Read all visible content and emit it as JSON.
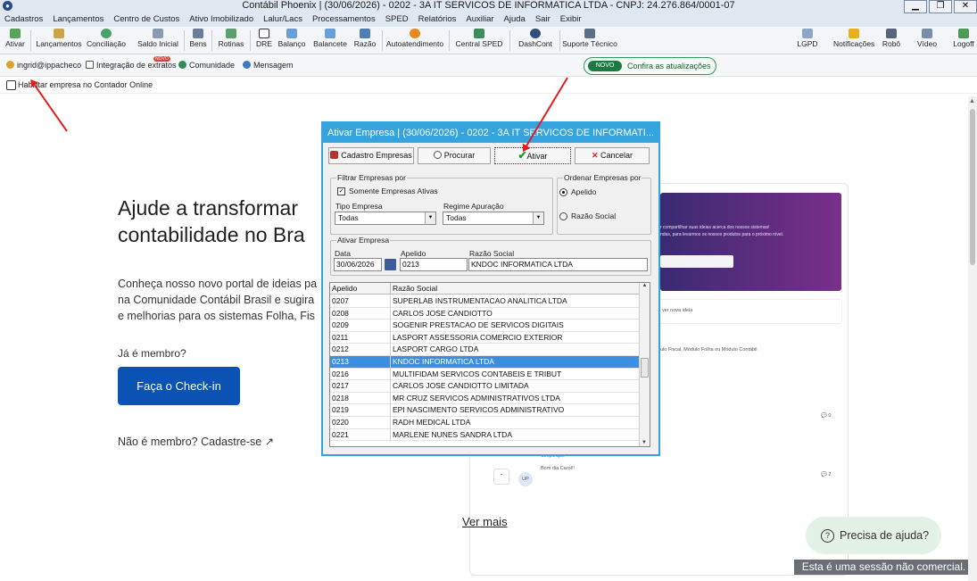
{
  "window": {
    "title": "Contábil Phoenix | (30/06/2026) - 0202 - 3A IT SERVICOS DE INFORMATICA LTDA - CNPJ: 24.276.864/0001-07",
    "minimize": "▁",
    "restore": "❐",
    "close": "✕"
  },
  "menu": [
    "Cadastros",
    "Lançamentos",
    "Centro de Custos",
    "Ativo Imobilizado",
    "Lalur/Lacs",
    "Processamentos",
    "SPED",
    "Relatórios",
    "Auxiliar",
    "Ajuda",
    "Sair",
    "Exibir"
  ],
  "toolbar": {
    "ativar": "Ativar",
    "lancamentos": "Lançamentos",
    "conciliacao": "Conciliação",
    "saldo_inicial": "Saldo Inicial",
    "bens": "Bens",
    "rotinas": "Rotinas",
    "dre": "DRE",
    "balanco": "Balanço",
    "balancete": "Balancete",
    "razao": "Razão",
    "autoatendimento": "Autoatendimento",
    "central_sped": "Central SPED",
    "dashcont": "DashCont",
    "suporte_tecnico": "Suporte Técnico",
    "lgpd": "LGPD",
    "notificacoes": "Notificações",
    "robo": "Robô",
    "video": "Vídeo",
    "logoff": "Logoff"
  },
  "linkbar": {
    "email": "ingrid@ippacheco",
    "integracao": "Integração de extratos",
    "integracao_badge": "NOVO",
    "comunidade": "Comunidade",
    "mensagem": "Mensagem"
  },
  "update_pill": {
    "tag": "NOVO",
    "text": "Confira as atualizações"
  },
  "habilitar": "Habilitar empresa no Contador Online",
  "page": {
    "hero_line1": "Ajude a transformar",
    "hero_line2": "contabilidade no Bra",
    "sub_line1": "Conheça nosso novo portal de ideias pa",
    "sub_line2": "na Comunidade Contábil Brasil e sugira",
    "sub_line3": "e melhorias para os sistemas Folha, Fis",
    "ja_membro": "Já é membro?",
    "checkin": "Faça o Check-in",
    "nao_membro": "Não é membro? Cadastre-se",
    "ver_mais": "Ver mais",
    "help": "Precisa de ajuda?",
    "sessao": "Esta é uma sessão não comercial.",
    "banner_l1": "r compartilhar suas ideias acerca dos nossos sistemas!",
    "banner_l2": "ndas, para levarmos os nossos produtos para o próximo nível.",
    "card_text": "ver nova ideia",
    "side_text": "ulo Fiscal, Módulo Folha ou Módulo Contábil",
    "simplifique": "Simplifique",
    "bom": "Bom dia Carol!!",
    "up": "UP",
    "count0": "0",
    "count2": "2"
  },
  "dialog": {
    "title": "Ativar Empresa  | (30/06/2026) - 0202 - 3A IT SERVICOS DE INFORMATI...",
    "btn_cadastro": "Cadastro Empresas",
    "btn_procurar": "Procurar",
    "btn_ativar": "Ativar",
    "btn_cancelar": "Cancelar",
    "filtrar_legend": "Filtrar Empresas por",
    "somente_ativas": "Somente Empresas Ativas",
    "tipo_empresa_label": "Tipo Empresa",
    "tipo_empresa_value": "Todas",
    "regime_label": "Regime Apuração",
    "regime_value": "Todas",
    "ordenar_legend": "Ordenar Empresas por",
    "opt_apelido": "Apelido",
    "opt_razao": "Razão Social",
    "ativar_legend": "Ativar Empresa",
    "data_label": "Data",
    "data_value": "30/06/2026",
    "apelido_label": "Apelido",
    "apelido_value": "0213",
    "razao_label": "Razão Social",
    "razao_value": "KNDOC INFORMATICA LTDA",
    "grid_col1": "Apelido",
    "grid_col2": "Razão Social",
    "rows": [
      {
        "code": "0207",
        "name": "SUPERLAB INSTRUMENTACAO ANALITICA LTDA"
      },
      {
        "code": "0208",
        "name": "CARLOS JOSE CANDIOTTO"
      },
      {
        "code": "0209",
        "name": "SOGENIR PRESTACAO DE SERVICOS DIGITAIS"
      },
      {
        "code": "0211",
        "name": "LASPORT ASSESSORIA COMERCIO EXTERIOR"
      },
      {
        "code": "0212",
        "name": "LASPORT CARGO LTDA"
      },
      {
        "code": "0213",
        "name": "KNDOC INFORMATICA LTDA"
      },
      {
        "code": "0216",
        "name": "MULTIFIDAM SERVICOS CONTABEIS E TRIBUT"
      },
      {
        "code": "0217",
        "name": "CARLOS JOSE CANDIOTTO LIMITADA"
      },
      {
        "code": "0218",
        "name": "MR CRUZ SERVICOS ADMINISTRATIVOS LTDA"
      },
      {
        "code": "0219",
        "name": "EPI NASCIMENTO SERVICOS ADMINISTRATIVO"
      },
      {
        "code": "0220",
        "name": "RADH MEDICAL LTDA"
      },
      {
        "code": "0221",
        "name": "MARLENE NUNES SANDRA LTDA"
      }
    ],
    "selected_row": 5
  },
  "colors": {
    "accent": "#35a3de",
    "selection": "#3c8ee0",
    "checkin": "#0b52b5",
    "arrow": "#e02020"
  }
}
